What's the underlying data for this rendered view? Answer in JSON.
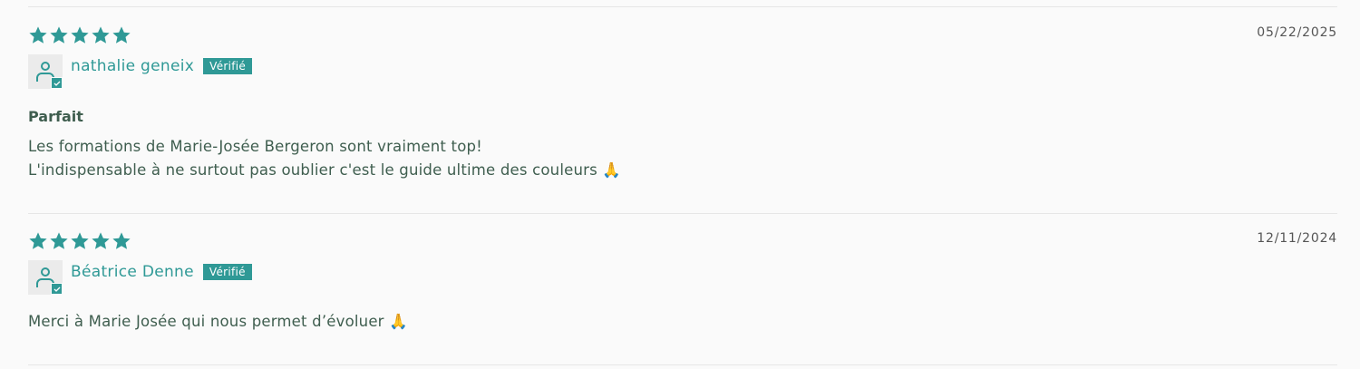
{
  "colors": {
    "accent": "#2f9996",
    "text": "#3f5e4f",
    "date_text": "#555555",
    "divider": "#e6e6e6",
    "background": "#fafafa"
  },
  "reviews": [
    {
      "rating": 5,
      "date": "05/22/2025",
      "author": "nathalie geneix",
      "badge": "Vérifié",
      "title": "Parfait",
      "body": [
        "Les formations de Marie-Josée Bergeron sont vraiment top!",
        "L'indispensable à ne surtout pas oublier c'est le guide ultime des couleurs 🙏"
      ]
    },
    {
      "rating": 5,
      "date": "12/11/2024",
      "author": "Béatrice Denne",
      "badge": "Vérifié",
      "title": "",
      "body": [
        "Merci à Marie Josée qui nous permet d’évoluer 🙏"
      ]
    }
  ]
}
